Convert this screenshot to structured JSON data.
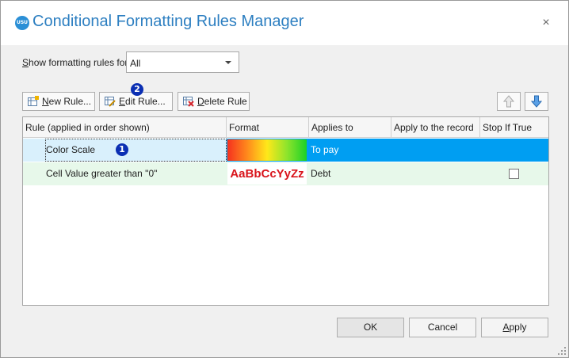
{
  "window": {
    "app_icon_text": "USU",
    "title": "Conditional Formatting Rules Manager",
    "close_glyph": "×"
  },
  "show_rules": {
    "label_accel": "S",
    "label_rest": "how formatting rules for:",
    "selected": "All"
  },
  "toolbar": {
    "new_accel": "N",
    "new_rest": "ew Rule...",
    "edit_accel": "E",
    "edit_rest": "dit Rule...",
    "delete_accel": "D",
    "delete_rest": "elete Rule"
  },
  "badges": {
    "edit": "2",
    "row": "1"
  },
  "table": {
    "columns": [
      "Rule (applied in order shown)",
      "Format",
      "Applies to",
      "Apply to the record",
      "Stop If True"
    ],
    "rows": [
      {
        "rule": "Color Scale",
        "format": "color-scale",
        "applies_to": "To pay",
        "apply_to_record": "",
        "stop_if_true": null
      },
      {
        "rule": "Cell Value greater than \"0\"",
        "format_sample": "AaBbCcYyZz",
        "applies_to": "Debt",
        "apply_to_record": "",
        "stop_if_true": false
      }
    ]
  },
  "footer": {
    "ok": "OK",
    "cancel": "Cancel",
    "apply_accel": "A",
    "apply_rest": "pply"
  },
  "colors": {
    "title": "#2d7fc1",
    "selected_row": "#009ef2",
    "second_row": "#e7f8ea",
    "sample_text": "#d9141b",
    "badge": "#0b2fb3"
  },
  "icons": [
    "close-icon",
    "dropdown-arrow-icon",
    "new-rule-icon",
    "edit-rule-icon",
    "delete-rule-icon",
    "move-up-icon",
    "move-down-icon",
    "resize-grip-icon"
  ]
}
